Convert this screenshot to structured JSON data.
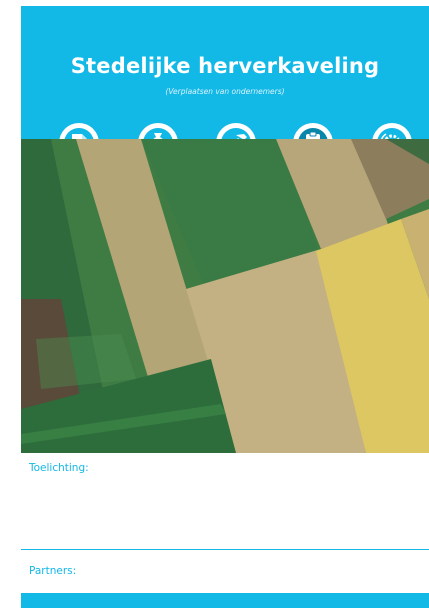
{
  "header": {
    "title": "Stedelijke herverkaveling",
    "subtitle": "(Verplaatsen van ondernemers)"
  },
  "icons": [
    "document-pen-icon",
    "money-bag-euro-icon",
    "hammer-icon",
    "clipboard-list-icon",
    "gear-cycle-icon"
  ],
  "sections": {
    "explanation_label": "Toelichting:",
    "partners_label": "Partners:"
  },
  "colors": {
    "accent": "#12b8e6",
    "panel": "#ffffff"
  }
}
